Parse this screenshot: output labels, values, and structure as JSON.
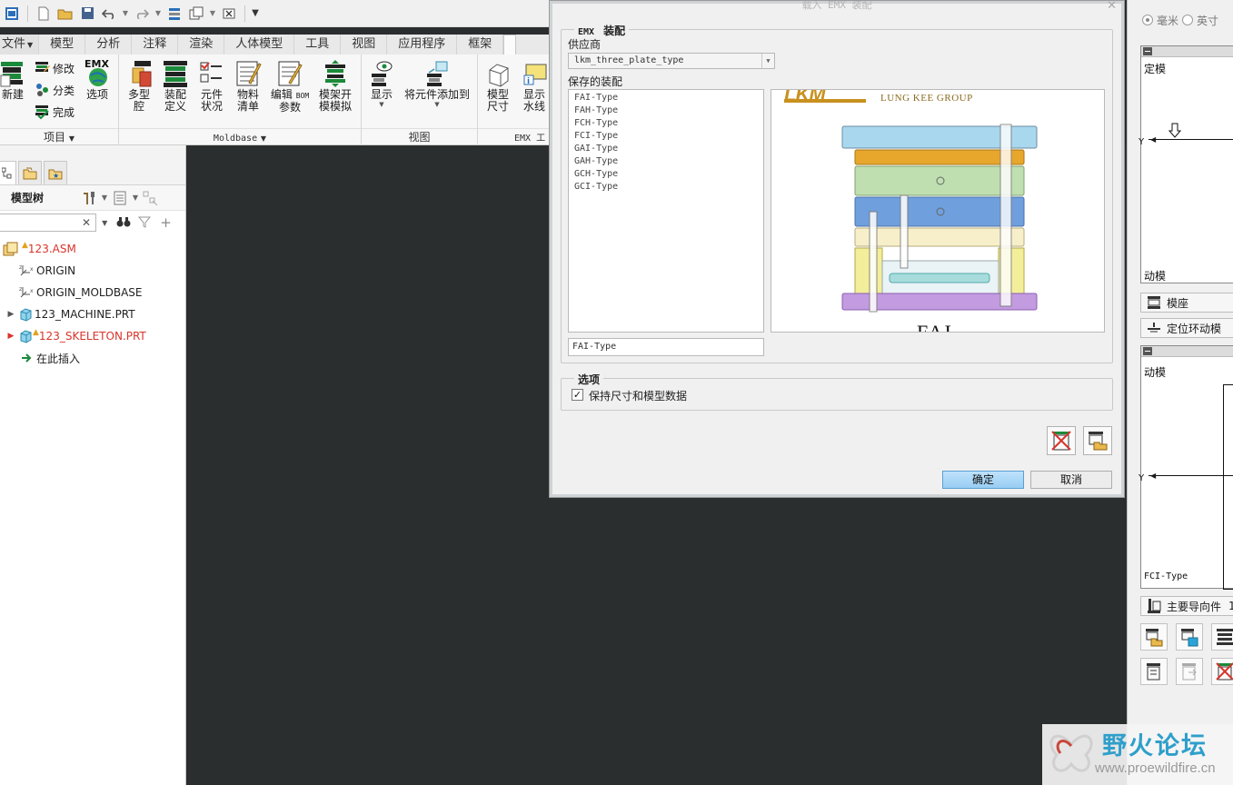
{
  "ribbon": {
    "file_tab": "文件",
    "tabs": [
      "模型",
      "分析",
      "注释",
      "渲染",
      "人体模型",
      "工具",
      "视图",
      "应用程序",
      "框架"
    ],
    "groups": {
      "project": {
        "label": "项目",
        "new": "新建",
        "modify": "修改",
        "classify": "分类",
        "finish": "完成",
        "options": "选项",
        "emx_badge": "EMX"
      },
      "moldbase": {
        "label": "Moldbase",
        "multi_cavity": [
          "多型",
          "腔"
        ],
        "assembly_def": [
          "装配",
          "定义"
        ],
        "component_status": [
          "元件",
          "状况"
        ],
        "bom": [
          "物料",
          "清单"
        ],
        "edit_bom": [
          "编辑",
          "参数"
        ],
        "edit_bom_tag": "BOM",
        "mold_open": [
          "模架开",
          "模模拟"
        ]
      },
      "view": {
        "label": "视图",
        "display": "显示",
        "add_component": "将元件添加到"
      },
      "emx_tools": {
        "label": "EMX 工",
        "mold_size": [
          "模型",
          "尺寸"
        ],
        "show_waterline": [
          "显示",
          "水线"
        ]
      }
    }
  },
  "model_tree": {
    "title": "模型树",
    "search_value": "",
    "items": [
      {
        "label": "123.ASM",
        "red": true,
        "expander": "",
        "warning": true
      },
      {
        "label": "ORIGIN",
        "red": false,
        "expander": "",
        "warning": false
      },
      {
        "label": "ORIGIN_MOLDBASE",
        "red": false,
        "expander": "",
        "warning": false
      },
      {
        "label": "123_MACHINE.PRT",
        "red": false,
        "expander": "▶",
        "warning": false
      },
      {
        "label": "123_SKELETON.PRT",
        "red": true,
        "expander": "▶",
        "warning": true
      },
      {
        "label": "在此插入",
        "red": false,
        "expander": "",
        "warning": false
      }
    ]
  },
  "dialog": {
    "title": "载入 EMX 装配",
    "legend_prefix": "EMX",
    "legend": "装配",
    "vendor_label": "供应商",
    "vendor_value": "lkm_three_plate_type",
    "saved_label": "保存的装配",
    "saved_items": [
      "FAI-Type",
      "FAH-Type",
      "FCH-Type",
      "FCI-Type",
      "GAI-Type",
      "GAH-Type",
      "GCH-Type",
      "GCI-Type"
    ],
    "selected_name": "FAI-Type",
    "preview": {
      "logo": "LKM",
      "company": "LUNG KEE GROUP",
      "caption": "FAI"
    },
    "options_legend": "选项",
    "keep_dims_label": "保持尺寸和模型数据",
    "keep_dims_checked": true,
    "ok": "确定",
    "cancel": "取消"
  },
  "right_panel": {
    "unit_mm": "毫米",
    "unit_inch": "英寸",
    "fixed_half": "定模",
    "moving_half_top": "动模",
    "axis_y": "Y",
    "moldbase_btn": "模座",
    "locating_ring_btn": "定位环动模",
    "moving_half_label": "动模",
    "axis_y2": "Y",
    "type_label": "FCI-Type",
    "guide_btn": "主要导向件",
    "guide_count": "1"
  },
  "watermark": {
    "text": "野火论坛",
    "url": "www.proewildfire.cn"
  },
  "colors": {
    "accent_blue": "#98cdf3",
    "graphics_bg": "#2b2e2f",
    "tree_red": "#d8342b"
  }
}
